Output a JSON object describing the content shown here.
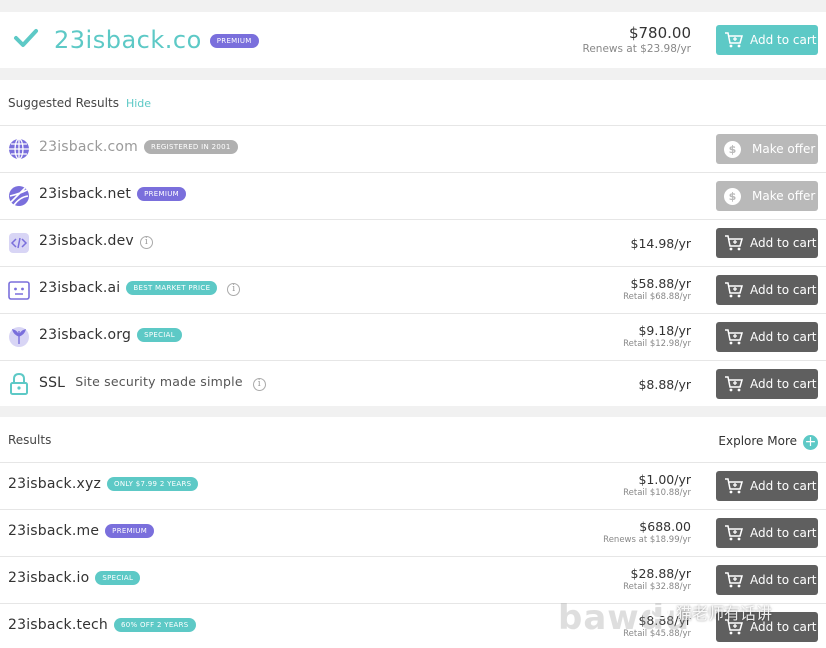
{
  "top": {
    "domain": "23isback.co",
    "badge": "PREMIUM",
    "price": "$780.00",
    "renews": "Renews at $23.98/yr",
    "button": "Add to cart"
  },
  "suggested": {
    "title": "Suggested Results",
    "hide": "Hide",
    "rows": [
      {
        "name": "23isback.com",
        "badge": "REGISTERED IN 2001",
        "button": "Make offer"
      },
      {
        "name": "23isback.net",
        "badge": "PREMIUM",
        "button": "Make offer"
      },
      {
        "name": "23isback.dev",
        "info": "i",
        "price": "$14.98/yr",
        "button": "Add to cart"
      },
      {
        "name": "23isback.ai",
        "badge": "BEST MARKET PRICE",
        "info": "i",
        "price": "$58.88/yr",
        "sub": "Retail $68.88/yr",
        "button": "Add to cart"
      },
      {
        "name": "23isback.org",
        "badge": "SPECIAL",
        "price": "$9.18/yr",
        "sub": "Retail $12.98/yr",
        "button": "Add to cart"
      },
      {
        "name": "SSL",
        "tagline": "Site security made simple",
        "info": "i",
        "price": "$8.88/yr",
        "button": "Add to cart"
      }
    ]
  },
  "results": {
    "title": "Results",
    "explore": "Explore More",
    "explore_icon": "+",
    "rows": [
      {
        "name": "23isback.xyz",
        "badge": "ONLY $7.99 2 YEARS",
        "price": "$1.00/yr",
        "sub": "Retail $10.88/yr",
        "button": "Add to cart"
      },
      {
        "name": "23isback.me",
        "badge": "PREMIUM",
        "price": "$688.00",
        "sub": "Renews at $18.99/yr",
        "button": "Add to cart"
      },
      {
        "name": "23isback.io",
        "badge": "SPECIAL",
        "price": "$28.88/yr",
        "sub": "Retail $32.88/yr",
        "button": "Add to cart"
      },
      {
        "name": "23isback.tech",
        "badge": "60% OFF 2 YEARS",
        "price": "$8.88/yr",
        "sub": "Retail $45.88/yr",
        "button": "Add to cart"
      }
    ]
  },
  "watermark": {
    "baidu": "bawdu",
    "wechat": "猫老师有话讲"
  },
  "colors": {
    "accent": "#5dc9c6",
    "premium": "#7a6fdc",
    "button_dark": "#5f5f5f",
    "button_disabled": "#b9b9b9"
  },
  "icons": {
    "check": "check-icon",
    "com": "globe-icon",
    "net": "net-icon",
    "dev": "code-icon",
    "ai": "robot-icon",
    "org": "org-icon",
    "ssl": "lock-icon",
    "cart": "cart-icon",
    "offer": "dollar-icon",
    "info": "info-icon",
    "explore": "plus-icon"
  }
}
